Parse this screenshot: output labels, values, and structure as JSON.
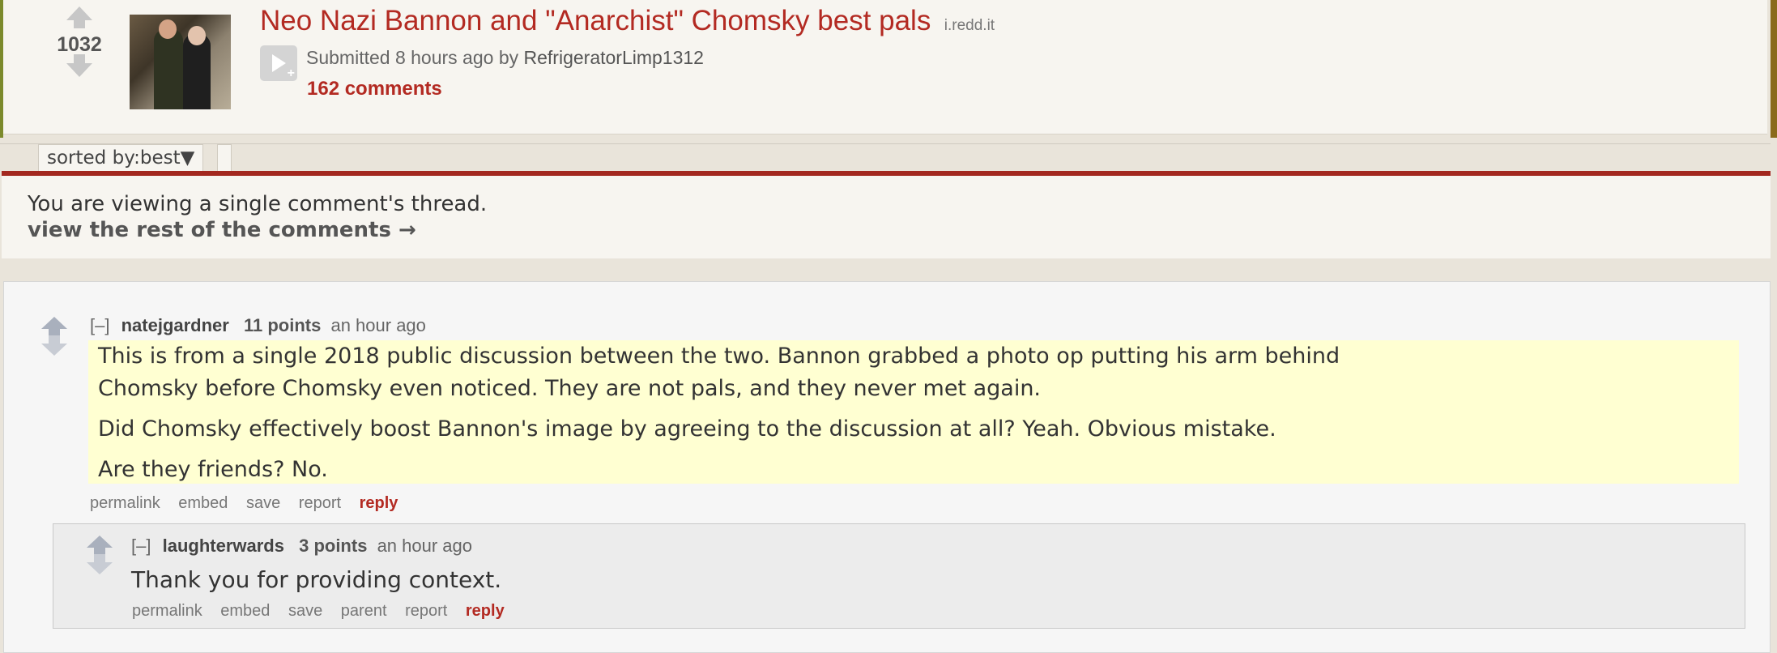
{
  "post": {
    "score": "1032",
    "title": "Neo Nazi Bannon and \"Anarchist\" Chomsky best pals",
    "domain": "i.redd.it",
    "submitted_prefix": "Submitted",
    "time_ago": "8 hours ago",
    "by": "by",
    "author": "RefrigeratorLimp1312",
    "comments_link": "162 comments"
  },
  "sort": {
    "label": "sorted by:",
    "value": "best",
    "caret": "▼"
  },
  "notice": {
    "line1": "You are viewing a single comment's thread.",
    "line2": "view the rest of the comments →"
  },
  "comment": {
    "collapse": "[–]",
    "author": "natejgardner",
    "score": "11 points",
    "time": "an hour ago",
    "paragraphs": [
      "This is from a single 2018 public discussion between the two. Bannon grabbed a photo op putting his arm behind",
      "Chomsky before Chomsky even noticed. They are not pals, and they never met again.",
      "Did Chomsky effectively boost Bannon's image by agreeing to the discussion at all? Yeah. Obvious mistake.",
      "Are they friends? No."
    ],
    "buttons": {
      "permalink": "permalink",
      "embed": "embed",
      "save": "save",
      "report": "report",
      "reply": "reply"
    }
  },
  "child": {
    "collapse": "[–]",
    "author": "laughterwards",
    "score": "3 points",
    "time": "an hour ago",
    "body": "Thank you for providing context.",
    "buttons": {
      "permalink": "permalink",
      "embed": "embed",
      "save": "save",
      "parent": "parent",
      "report": "report",
      "reply": "reply"
    }
  },
  "colors": {
    "title_red": "#b32a22",
    "highlight": "#ffffd2",
    "page_bg": "#e9e4da"
  }
}
